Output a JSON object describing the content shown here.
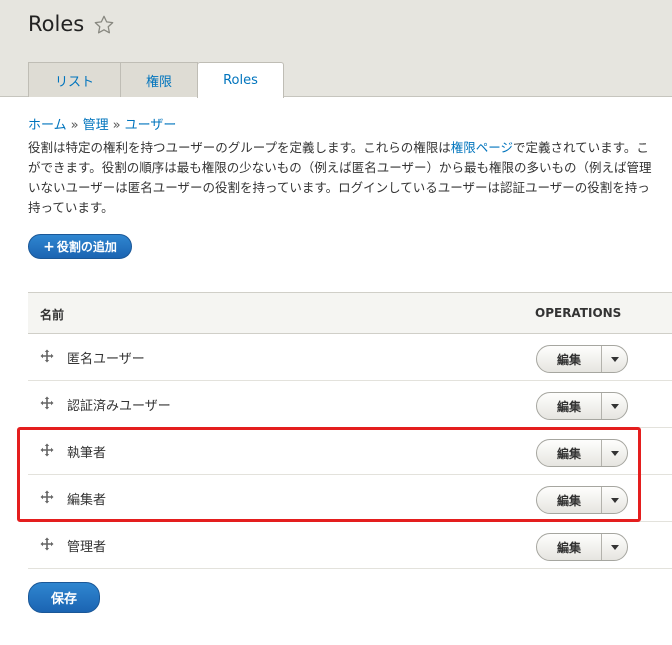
{
  "header": {
    "title": "Roles",
    "tabs": [
      {
        "label": "リスト"
      },
      {
        "label": "権限"
      },
      {
        "label": "Roles"
      }
    ]
  },
  "breadcrumb": {
    "items": [
      "ホーム",
      "管理",
      "ユーザー"
    ],
    "separator": "»"
  },
  "description": {
    "line1_before": "役割は特定の権利を持つユーザーのグループを定義します。これらの権限は",
    "line1_link": "権限ページ",
    "line1_after": "で定義されています。こ",
    "line2": "ができます。役割の順序は最も権限の少ないもの（例えば匿名ユーザー）から最も権限の多いもの（例えば管理",
    "line3": "いないユーザーは匿名ユーザーの役割を持っています。ログインしているユーザーは認証ユーザーの役割を持っ",
    "line4": "持っています。"
  },
  "actions": {
    "add_role_plus": "+",
    "add_role_label": "役割の追加",
    "save_label": "保存"
  },
  "table": {
    "headers": {
      "name": "名前",
      "operations": "OPERATIONS"
    },
    "rows": [
      {
        "name": "匿名ユーザー",
        "edit_label": "編集"
      },
      {
        "name": "認証済みユーザー",
        "edit_label": "編集"
      },
      {
        "name": "執筆者",
        "edit_label": "編集"
      },
      {
        "name": "編集者",
        "edit_label": "編集"
      },
      {
        "name": "管理者",
        "edit_label": "編集"
      }
    ]
  },
  "colors": {
    "link": "#0074bd",
    "primary_button": "#1b64b2",
    "highlight": "#e41e1e",
    "header_bg": "#e6e5df"
  },
  "icons": {
    "star": "star-outline-icon",
    "drag": "drag-handle-icon",
    "dropdown": "chevron-down-icon"
  }
}
